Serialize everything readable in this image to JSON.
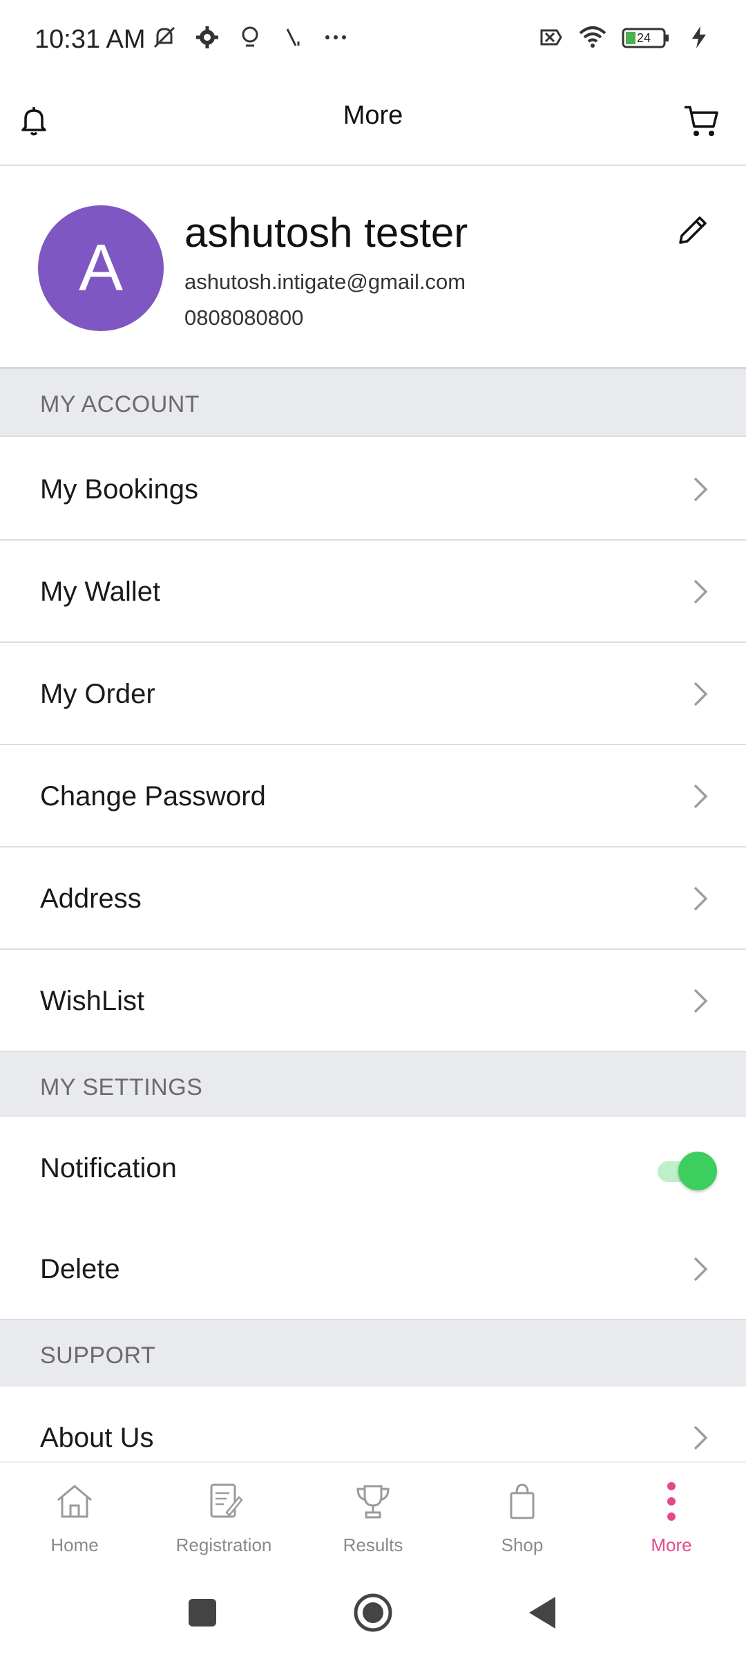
{
  "status_bar": {
    "time": "10:31 AM",
    "battery": "24"
  },
  "header": {
    "title": "More"
  },
  "profile": {
    "initial": "A",
    "name": "ashutosh tester",
    "email": "ashutosh.intigate@gmail.com",
    "phone": "0808080800"
  },
  "sections": {
    "account": "MY ACCOUNT",
    "settings": "MY SETTINGS",
    "support": "SUPPORT"
  },
  "account_items": [
    {
      "label": "My Bookings"
    },
    {
      "label": "My Wallet"
    },
    {
      "label": "My Order"
    },
    {
      "label": "Change Password"
    },
    {
      "label": "Address"
    },
    {
      "label": "WishList"
    }
  ],
  "settings_items": {
    "notification": {
      "label": "Notification",
      "enabled": true
    },
    "delete": {
      "label": "Delete"
    }
  },
  "support_items": [
    {
      "label": "About Us"
    }
  ],
  "bottom_nav": [
    {
      "label": "Home",
      "icon": "home-icon"
    },
    {
      "label": "Registration",
      "icon": "registration-icon"
    },
    {
      "label": "Results",
      "icon": "trophy-icon"
    },
    {
      "label": "Shop",
      "icon": "shopping-bag-icon"
    },
    {
      "label": "More",
      "icon": "more-vertical-icon",
      "active": true
    }
  ],
  "colors": {
    "accent": "#e24a8d",
    "avatar": "#7e57c2",
    "toggle_on": "#3ccf5f"
  }
}
